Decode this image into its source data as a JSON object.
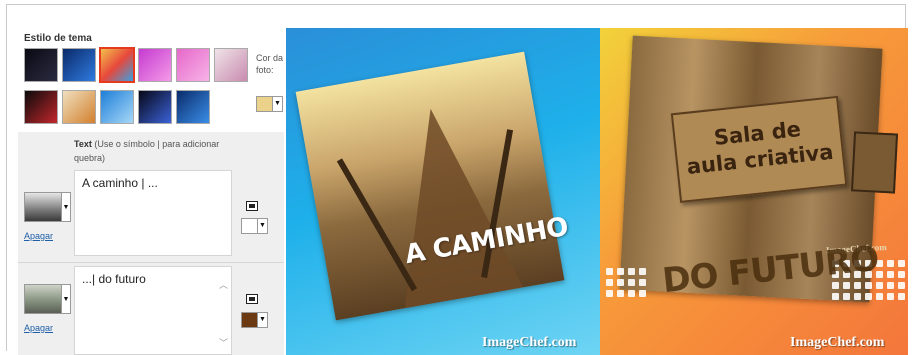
{
  "theme": {
    "title": "Estilo de tema",
    "swatches_row1": [
      {
        "name": "sparkle-black",
        "colors": [
          "#0a0a14",
          "#2b2b40"
        ]
      },
      {
        "name": "blue-bokeh",
        "colors": [
          "#0b2a6a",
          "#2f7be0"
        ]
      },
      {
        "name": "rainbow",
        "colors": [
          "#f2c04b",
          "#e8483c",
          "#3aa0e0"
        ]
      },
      {
        "name": "pink-glow",
        "colors": [
          "#c43bd0",
          "#f59ae8"
        ]
      },
      {
        "name": "pink-hearts",
        "colors": [
          "#e668c9",
          "#f7b3e8"
        ]
      },
      {
        "name": "flowers-white",
        "colors": [
          "#efe3e6",
          "#c98bb0"
        ]
      }
    ],
    "swatches_row2": [
      {
        "name": "hearts-dark",
        "colors": [
          "#0b0b0b",
          "#c2262c"
        ]
      },
      {
        "name": "leaves-autumn",
        "colors": [
          "#f0dfbf",
          "#d2802e"
        ]
      },
      {
        "name": "snowflakes-blue",
        "colors": [
          "#1e7fd8",
          "#a7d7f7"
        ]
      },
      {
        "name": "fireworks",
        "colors": [
          "#070716",
          "#3a62d8"
        ]
      },
      {
        "name": "blue-sparkle",
        "colors": [
          "#0b2c6b",
          "#3a8ee8"
        ]
      }
    ],
    "selected_index": 2,
    "photo_color_label": "Cor da foto:",
    "photo_color": "#ecd18a"
  },
  "text_section": {
    "heading_bold": "Text",
    "heading_hint": " (Use o símbolo | para adicionar quebra)",
    "rows": [
      {
        "value": "A caminho | ...",
        "delete_label": "Apagar",
        "color": "#ffffff"
      },
      {
        "value": "...| do futuro",
        "delete_label": "Apagar",
        "color": "#6b3a12"
      }
    ]
  },
  "preview": {
    "left_title": "A CAMINHO",
    "right_sign_line1": "Sala de",
    "right_sign_line2": "aula criativa",
    "right_title": "DO FUTURO",
    "watermark": "ImageChef.com",
    "sign_watermark": "ImageChef.com"
  }
}
